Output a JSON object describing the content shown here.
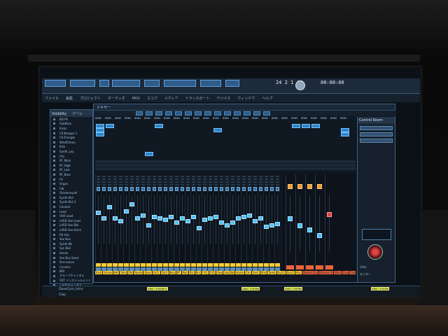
{
  "transport": {
    "time_a": "24 2 1 47",
    "time_b": "00:00:00"
  },
  "menu": [
    "ファイル",
    "編集",
    "プロジェクト",
    "オーディオ",
    "MIDI",
    "スコア",
    "メディア",
    "トランスポート",
    "デバイス",
    "ウィンドウ",
    "ヘルプ"
  ],
  "visibility": {
    "tabs": [
      "Visibility",
      "ゾーン"
    ],
    "items": [
      "BD PS",
      "SubBass",
      "Kicks",
      "CS-Bongos 1",
      "CS-Triangle",
      "WindChime",
      "Kick",
      "Synth_Lay",
      "FXs",
      "PF_Main",
      "PF_High",
      "PF_Low",
      "PF_Bass",
      "FX",
      "Organ",
      "Vib",
      "Glockenspiel",
      "Synth Brd",
      "Synth Brd 2",
      "Counter",
      "Lead",
      "VOX Lead",
      "LASD Vox Lead",
      "LASD Vox Dbl",
      "LASD Vox Harm",
      "RX Vox",
      "Vox Bus",
      "Synth Bk",
      "Syn Bk2",
      "Sends",
      "Vox Bus Send",
      "Percussion",
      "Counter",
      "MIX",
      "グループチャンネル",
      "VST インストゥルメント",
      "入出力チャンネル",
      "Master"
    ]
  },
  "mixer": {
    "title": "ミキサー",
    "channel_count": 33,
    "master_count": 5,
    "channel_labels": [
      "Kick",
      "Snare",
      "HH",
      "Tom",
      "OH",
      "Room",
      "Bass",
      "Gtr1",
      "Gtr2",
      "Key",
      "PF",
      "Pad",
      "Str",
      "Brs",
      "FX1",
      "FX2",
      "Vox",
      "VoxDbl",
      "Harm",
      "Chr",
      "Perc",
      "Shk",
      "Tamb",
      "Syn1",
      "Syn2",
      "Arp"
    ],
    "master_labels": [
      "Stereo Out",
      "Stereo In",
      "Mon",
      "Cue",
      "Out"
    ]
  },
  "control_room": {
    "title": "Control Room",
    "label": "Click",
    "buttons": "モニター"
  },
  "timeline": {
    "tracks": [
      "DaveCym_Intro",
      "Clap"
    ],
    "clips": [
      "Clap - 1 B Dbl 1",
      "Clap - 1 B Dbl 2",
      "Clap - 1 B Dbl 3",
      "Clap - 1 B Dbl 4"
    ]
  },
  "colors": {
    "accent": "#2b86c9",
    "channel_label": "#ffcf33",
    "master_label": "#e9633c",
    "led": "#f19b2c"
  }
}
